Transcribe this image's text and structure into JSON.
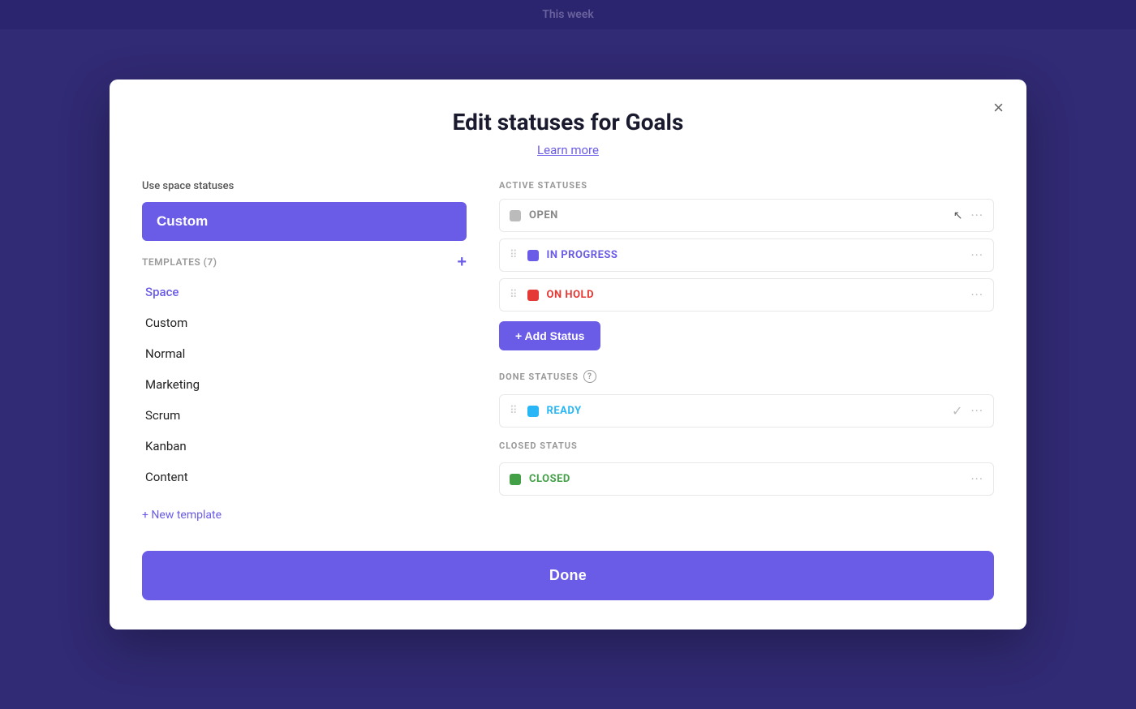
{
  "appBar": {
    "title": "This week"
  },
  "modal": {
    "title": "Edit statuses for Goals",
    "learnMore": "Learn more",
    "closeLabel": "×",
    "leftPanel": {
      "useSpaceLabel": "Use space statuses",
      "selectedBtn": "Custom",
      "templatesLabel": "TEMPLATES (7)",
      "templates": [
        {
          "name": "Space",
          "type": "space"
        },
        {
          "name": "Custom",
          "type": "normal"
        },
        {
          "name": "Normal",
          "type": "normal"
        },
        {
          "name": "Marketing",
          "type": "normal"
        },
        {
          "name": "Scrum",
          "type": "normal"
        },
        {
          "name": "Kanban",
          "type": "normal"
        },
        {
          "name": "Content",
          "type": "normal"
        }
      ],
      "newTemplate": "+ New template"
    },
    "rightPanel": {
      "activeStatusesLabel": "ACTIVE STATUSES",
      "activeStatuses": [
        {
          "name": "OPEN",
          "color": "gray",
          "cls": "open"
        },
        {
          "name": "IN PROGRESS",
          "color": "purple",
          "cls": "in-progress"
        },
        {
          "name": "ON HOLD",
          "color": "red",
          "cls": "on-hold"
        }
      ],
      "addStatusBtn": "+ Add Status",
      "doneStatusesLabel": "DONE STATUSES",
      "doneStatuses": [
        {
          "name": "READY",
          "color": "blue",
          "cls": "ready",
          "hasCheck": true
        }
      ],
      "closedStatusLabel": "CLOSED STATUS",
      "closedStatuses": [
        {
          "name": "CLOSED",
          "color": "green",
          "cls": "closed"
        }
      ]
    },
    "doneBtn": "Done"
  }
}
